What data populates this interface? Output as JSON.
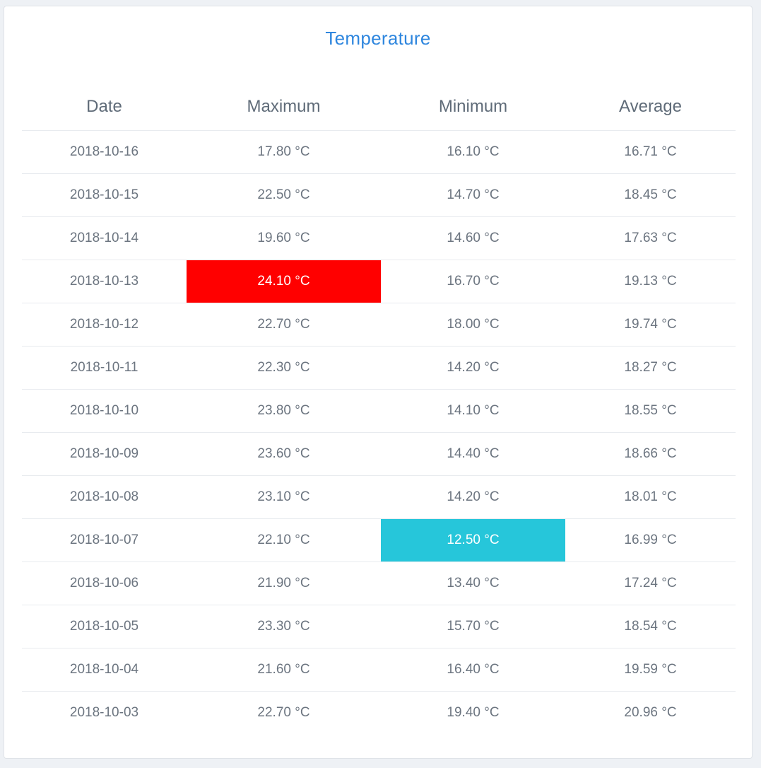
{
  "title": "Temperature",
  "headers": {
    "date": "Date",
    "max": "Maximum",
    "min": "Minimum",
    "avg": "Average"
  },
  "colors": {
    "title": "#2e86de",
    "highest_max": "#ff0000",
    "lowest_min": "#26c6da"
  },
  "rows": [
    {
      "date": "2018-10-16",
      "max": "17.80 °C",
      "min": "16.10 °C",
      "avg": "16.71 °C"
    },
    {
      "date": "2018-10-15",
      "max": "22.50 °C",
      "min": "14.70 °C",
      "avg": "18.45 °C"
    },
    {
      "date": "2018-10-14",
      "max": "19.60 °C",
      "min": "14.60 °C",
      "avg": "17.63 °C"
    },
    {
      "date": "2018-10-13",
      "max": "24.10 °C",
      "min": "16.70 °C",
      "avg": "19.13 °C"
    },
    {
      "date": "2018-10-12",
      "max": "22.70 °C",
      "min": "18.00 °C",
      "avg": "19.74 °C"
    },
    {
      "date": "2018-10-11",
      "max": "22.30 °C",
      "min": "14.20 °C",
      "avg": "18.27 °C"
    },
    {
      "date": "2018-10-10",
      "max": "23.80 °C",
      "min": "14.10 °C",
      "avg": "18.55 °C"
    },
    {
      "date": "2018-10-09",
      "max": "23.60 °C",
      "min": "14.40 °C",
      "avg": "18.66 °C"
    },
    {
      "date": "2018-10-08",
      "max": "23.10 °C",
      "min": "14.20 °C",
      "avg": "18.01 °C"
    },
    {
      "date": "2018-10-07",
      "max": "22.10 °C",
      "min": "12.50 °C",
      "avg": "16.99 °C"
    },
    {
      "date": "2018-10-06",
      "max": "21.90 °C",
      "min": "13.40 °C",
      "avg": "17.24 °C"
    },
    {
      "date": "2018-10-05",
      "max": "23.30 °C",
      "min": "15.70 °C",
      "avg": "18.54 °C"
    },
    {
      "date": "2018-10-04",
      "max": "21.60 °C",
      "min": "16.40 °C",
      "avg": "19.59 °C"
    },
    {
      "date": "2018-10-03",
      "max": "22.70 °C",
      "min": "19.40 °C",
      "avg": "20.96 °C"
    }
  ]
}
